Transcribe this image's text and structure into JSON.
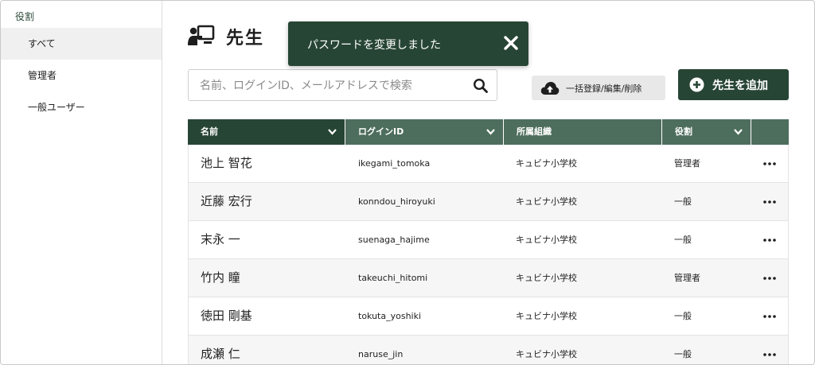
{
  "sidebar": {
    "heading": "役割",
    "items": [
      {
        "label": "すべて",
        "active": true
      },
      {
        "label": "管理者",
        "active": false
      },
      {
        "label": "一般ユーザー",
        "active": false
      }
    ]
  },
  "header": {
    "title": "先生",
    "title_icon": "teacher-board-icon"
  },
  "toast": {
    "message": "パスワードを変更しました",
    "close_icon": "close-icon"
  },
  "search": {
    "placeholder": "名前、ログインID、メールアドレスで検索",
    "value": "",
    "icon": "search-icon"
  },
  "toolbar": {
    "bulk_label": "一括登録/編集/削除",
    "bulk_icon": "cloud-upload-icon",
    "add_label": "先生を追加",
    "add_icon": "plus-circle-icon"
  },
  "table": {
    "columns": [
      {
        "label": "名前"
      },
      {
        "label": "ログインID"
      },
      {
        "label": "所属組織"
      },
      {
        "label": "役割"
      },
      {
        "label": ""
      }
    ],
    "rows": [
      {
        "name": "池上 智花",
        "login": "ikegami_tomoka",
        "org": "キュビナ小学校",
        "role": "管理者"
      },
      {
        "name": "近藤 宏行",
        "login": "konndou_hiroyuki",
        "org": "キュビナ小学校",
        "role": "一般"
      },
      {
        "name": "末永 一",
        "login": "suenaga_hajime",
        "org": "キュビナ小学校",
        "role": "一般"
      },
      {
        "name": "竹内 瞳",
        "login": "takeuchi_hitomi",
        "org": "キュビナ小学校",
        "role": "管理者"
      },
      {
        "name": "徳田 剛基",
        "login": "tokuta_yoshiki",
        "org": "キュビナ小学校",
        "role": "一般"
      },
      {
        "name": "成瀬 仁",
        "login": "naruse_jin",
        "org": "キュビナ小学校",
        "role": "一般"
      }
    ]
  },
  "colors": {
    "brand_dark": "#274535",
    "header_mid": "#4e6e5d",
    "sidebar_active_bg": "#f0f0f0"
  }
}
